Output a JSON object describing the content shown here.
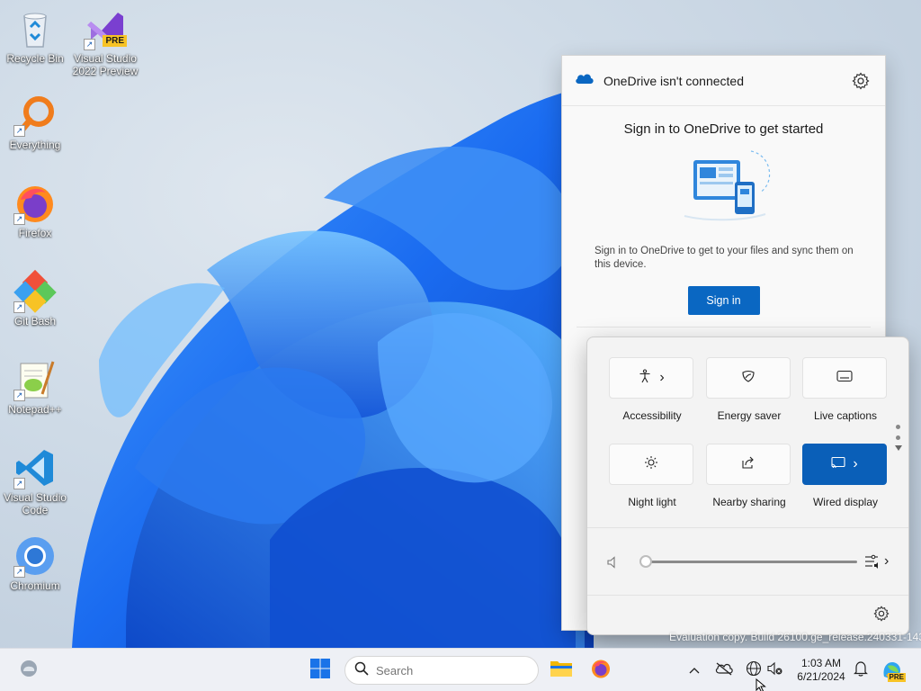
{
  "desktop": {
    "icons": [
      {
        "label": "Recycle Bin",
        "icon": "recycle-bin-icon"
      },
      {
        "label": "Visual Studio 2022 Preview",
        "badge": "PRE",
        "icon": "visual-studio-preview-icon"
      },
      {
        "label": "Everything",
        "icon": "everything-search-icon"
      },
      {
        "label": "Firefox",
        "icon": "firefox-icon"
      },
      {
        "label": "Git Bash",
        "icon": "git-bash-icon"
      },
      {
        "label": "Notepad++",
        "icon": "notepad-plus-plus-icon"
      },
      {
        "label": "Visual Studio Code",
        "icon": "vscode-icon"
      },
      {
        "label": "Chromium",
        "icon": "chromium-icon"
      }
    ],
    "shortcut_arrow": "↗"
  },
  "onedrive": {
    "title": "OneDrive isn't connected",
    "heading": "Sign in to OneDrive to get started",
    "description": "Sign in to OneDrive to get to your files and sync them on this device.",
    "signin_label": "Sign in",
    "accent": "#0a67c2"
  },
  "quick_settings": {
    "tiles": [
      {
        "label": "Accessibility",
        "icon": "accessibility-icon",
        "active": false,
        "chevron": "›"
      },
      {
        "label": "Energy saver",
        "icon": "energy-saver-icon",
        "active": false
      },
      {
        "label": "Live captions",
        "icon": "live-captions-icon",
        "active": false
      },
      {
        "label": "Night light",
        "icon": "night-light-icon",
        "active": false
      },
      {
        "label": "Nearby sharing",
        "icon": "nearby-sharing-icon",
        "active": false
      },
      {
        "label": "Wired display",
        "icon": "cast-icon",
        "active": true,
        "chevron": "›"
      }
    ],
    "volume": 0,
    "volume_chevron": "›",
    "active_color": "#0a5fb8"
  },
  "watermark": "Evaluation copy. Build 26100.ge_release.240331-1435",
  "taskbar": {
    "search_placeholder": "Search",
    "time": "1:03 AM",
    "date": "6/21/2024",
    "tray_overflow": "^",
    "copilot_badge": "PRE"
  }
}
